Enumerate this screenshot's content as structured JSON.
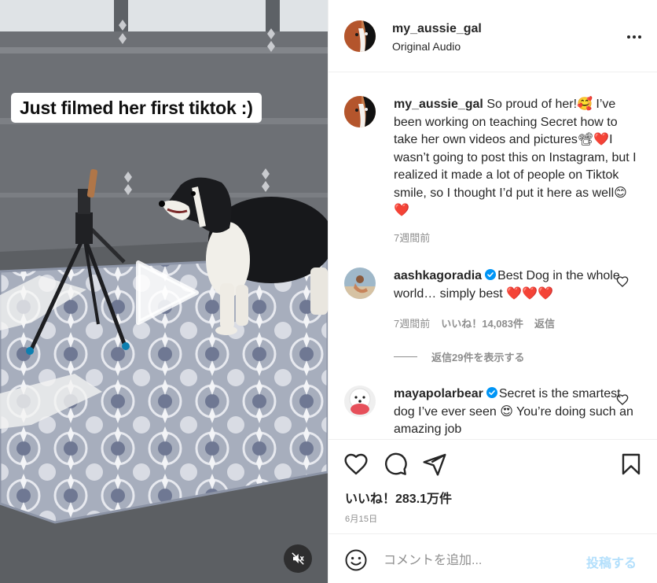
{
  "video": {
    "overlay_caption": "Just filmed her first tiktok :)"
  },
  "post": {
    "author": "my_aussie_gal",
    "audio": "Original Audio",
    "caption_author": "my_aussie_gal",
    "caption_text": "So proud of her!🥰 I’ve been working on teaching Secret how to take her own videos and pictures📽❤️I wasn’t going to post this on Instagram, but I realized it made a lot of people on Tiktok smile, so I thought I’d put it here as well😊❤️",
    "caption_time": "7週間前"
  },
  "comments": [
    {
      "username": "aashkagoradia",
      "verified": true,
      "text": "Best Dog in the whole world… simply best ❤️❤️❤️",
      "time": "7週間前",
      "likes": "いいね！14,083件",
      "reply_label": "返信",
      "view_replies": "返信29件を表示する"
    },
    {
      "username": "mayapolarbear",
      "verified": true,
      "text": "Secret is the smartest dog I’ve ever seen 😍 You’re doing such an amazing job"
    }
  ],
  "actions": {
    "likes_count": "いいね！283.1万件",
    "date": "6月15日"
  },
  "comment_box": {
    "placeholder": "コメントを追加...",
    "post_label": "投稿する"
  },
  "colors": {
    "verified": "#0095f6",
    "post_button_disabled": "#b2dffc",
    "secondary_text": "#8e8e8e",
    "primary_text": "#262626"
  },
  "icons": [
    "more-icon",
    "play-icon",
    "mute-icon",
    "heart-icon",
    "comment-icon",
    "share-icon",
    "bookmark-icon",
    "emoji-icon",
    "verified-icon"
  ]
}
